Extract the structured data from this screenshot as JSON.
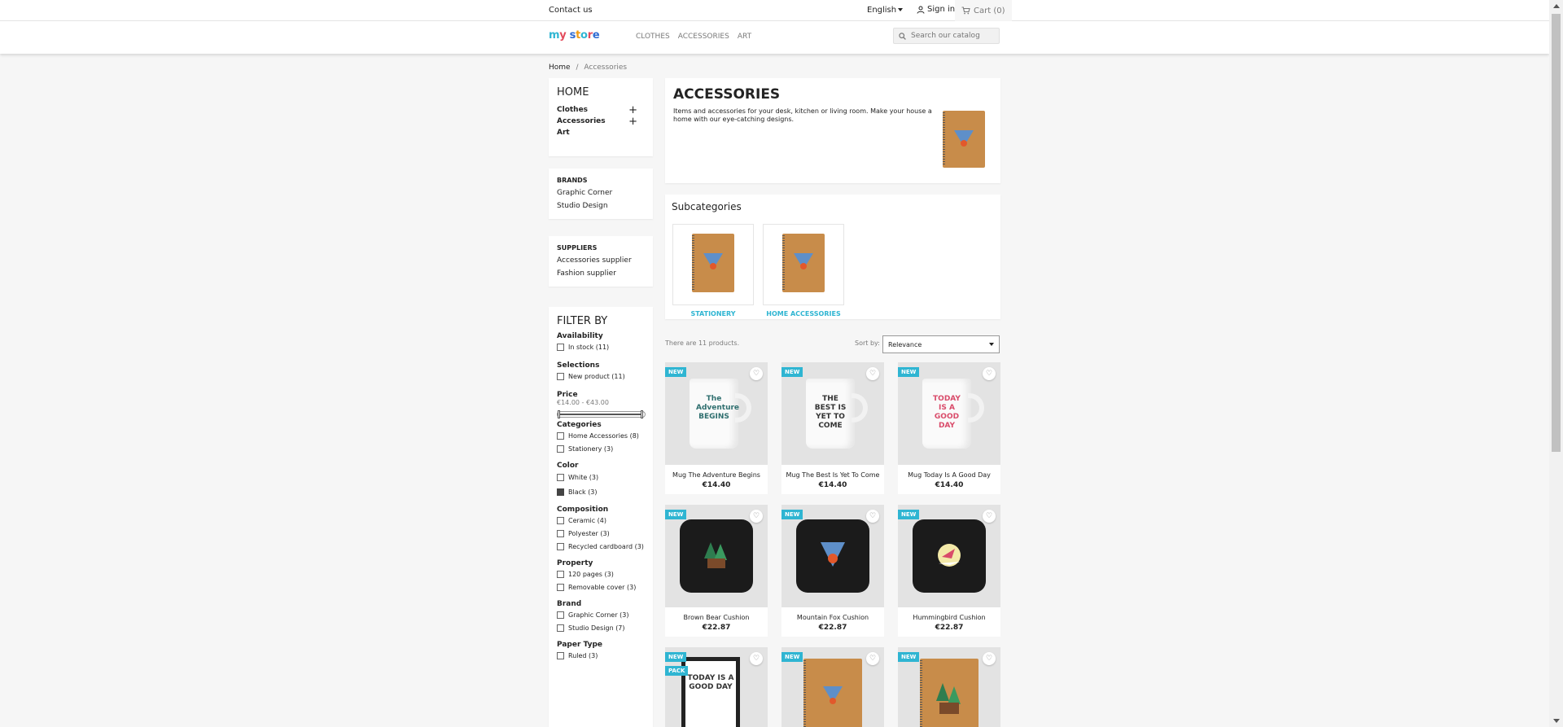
{
  "topbar": {
    "contact": "Contact us",
    "language": "English",
    "signin": "Sign in",
    "cart": "Cart (0)"
  },
  "header": {
    "logo": {
      "my": "my",
      "store": "store"
    },
    "nav": [
      "CLOTHES",
      "ACCESSORIES",
      "ART"
    ],
    "search_placeholder": "Search our catalog"
  },
  "breadcrumb": {
    "home": "Home",
    "separator": "/",
    "current": "Accessories"
  },
  "sidebar": {
    "home_title": "HOME",
    "categories": [
      {
        "label": "Clothes",
        "expand": "+"
      },
      {
        "label": "Accessories",
        "expand": "+"
      },
      {
        "label": "Art",
        "expand": ""
      }
    ],
    "brands_title": "BRANDS",
    "brands": [
      "Graphic Corner",
      "Studio Design"
    ],
    "suppliers_title": "SUPPLIERS",
    "suppliers": [
      "Accessories supplier",
      "Fashion supplier"
    ]
  },
  "filter": {
    "title": "FILTER BY",
    "availability": {
      "title": "Availability",
      "options": [
        "In stock (11)"
      ]
    },
    "selections": {
      "title": "Selections",
      "options": [
        "New product (11)"
      ]
    },
    "price": {
      "title": "Price",
      "range": "€14.00 - €43.00",
      "min_fraction": 0.0,
      "max_fraction": 1.0
    },
    "categories": {
      "title": "Categories",
      "options": [
        "Home Accessories (8)",
        "Stationery (3)"
      ]
    },
    "color": {
      "title": "Color",
      "options": [
        "White (3)",
        "Black (3)"
      ]
    },
    "composition": {
      "title": "Composition",
      "options": [
        "Ceramic (4)",
        "Polyester (3)",
        "Recycled cardboard (3)"
      ]
    },
    "property": {
      "title": "Property",
      "options": [
        "120 pages (3)",
        "Removable cover (3)"
      ]
    },
    "brand": {
      "title": "Brand",
      "options": [
        "Graphic Corner (3)",
        "Studio Design (7)"
      ]
    },
    "paper_type": {
      "title": "Paper Type",
      "options": [
        "Ruled (3)"
      ]
    }
  },
  "category": {
    "title": "ACCESSORIES",
    "description": "Items and accessories for your desk, kitchen or living room. Make your house a home with our eye-catching designs."
  },
  "subcategories": {
    "title": "Subcategories",
    "items": [
      "STATIONERY",
      "HOME ACCESSORIES"
    ]
  },
  "listing": {
    "count": "There are 11 products.",
    "sort_label": "Sort by:",
    "sort_value": "Relevance"
  },
  "products": [
    {
      "name": "Mug The Adventure Begins",
      "price": "€14.40",
      "badge": "NEW",
      "print": "The Adventure BEGINS"
    },
    {
      "name": "Mug The Best Is Yet To Come",
      "price": "€14.40",
      "badge": "NEW",
      "print": "THE BEST IS YET TO COME"
    },
    {
      "name": "Mug Today Is A Good Day",
      "price": "€14.40",
      "badge": "NEW",
      "print": "TODAY IS A GOOD DAY"
    },
    {
      "name": "Brown Bear Cushion",
      "price": "€22.87",
      "badge": "NEW"
    },
    {
      "name": "Mountain Fox Cushion",
      "price": "€22.87",
      "badge": "NEW"
    },
    {
      "name": "Hummingbird Cushion",
      "price": "€22.87",
      "badge": "NEW"
    },
    {
      "name": "",
      "price": "",
      "badge": "NEW",
      "badge2": "PACK",
      "print": "TODAY IS A GOOD DAY"
    },
    {
      "name": "",
      "price": "",
      "badge": "NEW"
    },
    {
      "name": "",
      "price": "",
      "badge": "NEW"
    }
  ],
  "colors": {
    "accent": "#2fb5d2",
    "background": "#f6f6f6"
  }
}
